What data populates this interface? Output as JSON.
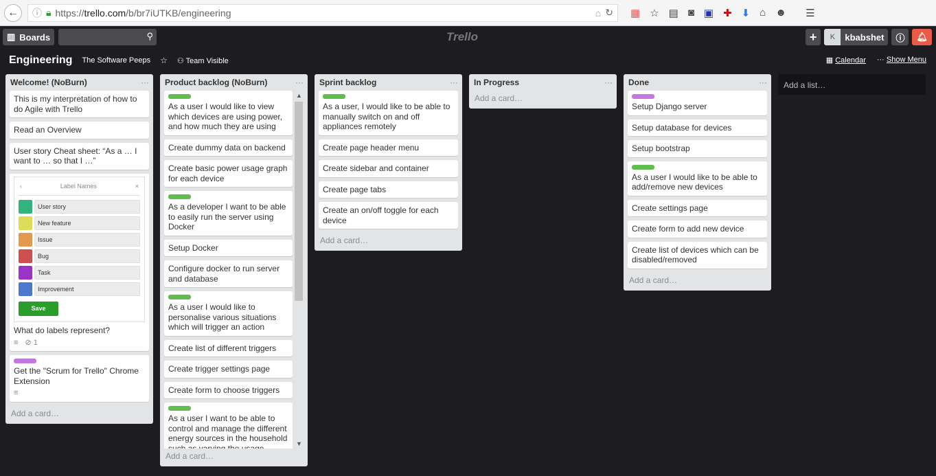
{
  "browser": {
    "url_prefix": "https://",
    "url_host": "trello.com",
    "url_path": "/b/br7iUTKB/engineering"
  },
  "topbar": {
    "boards_label": "Boards",
    "logo": "Trello",
    "user_initial": "K",
    "username": "kbabshet"
  },
  "board": {
    "title": "Engineering",
    "team": "The Software Peeps",
    "visibility": "Team Visible",
    "calendar": "Calendar",
    "show_menu": "Show Menu"
  },
  "add_card": "Add a card…",
  "add_list": "Add a list…",
  "colors": {
    "green": "#61bd4f",
    "purple": "#c377e0"
  },
  "lists": [
    {
      "title": "Welcome! (NoBurn)",
      "cards": [
        {
          "text": "This is my interpretation of how to do Agile with Trello"
        },
        {
          "text": "Read an Overview"
        },
        {
          "text": "User story Cheat sheet: “As a … I want to … so that I …”"
        },
        {
          "text": "What do labels represent?",
          "attachments": "1"
        },
        {
          "text": "Get the \"Scrum for Trello\" Chrome Extension",
          "label": "purple"
        }
      ]
    },
    {
      "title": "Product backlog (NoBurn)",
      "cards": [
        {
          "text": "As a user I would like to view which devices are using power, and how much they are using",
          "label": "green"
        },
        {
          "text": "Create dummy data on backend"
        },
        {
          "text": "Create basic power usage graph for each device"
        },
        {
          "text": "As a developer I want to be able to easily run the server using Docker",
          "label": "green"
        },
        {
          "text": "Setup Docker"
        },
        {
          "text": "Configure docker to run server and database"
        },
        {
          "text": "As a user I would like to personalise various situations which will trigger an action",
          "label": "green"
        },
        {
          "text": "Create list of different triggers"
        },
        {
          "text": "Create trigger settings page"
        },
        {
          "text": "Create form to choose triggers"
        },
        {
          "text": "As a user I want to be able to control and manage the different energy sources in the household such as varying the usage between them",
          "label": "green"
        }
      ]
    },
    {
      "title": "Sprint backlog",
      "cards": [
        {
          "text": "As a user, I would like to be able to manually switch on and off appliances remotely",
          "label": "green"
        },
        {
          "text": "Create page header menu"
        },
        {
          "text": "Create sidebar and container"
        },
        {
          "text": "Create page tabs"
        },
        {
          "text": "Create an on/off toggle for each device"
        }
      ]
    },
    {
      "title": "In Progress",
      "cards": []
    },
    {
      "title": "Done",
      "cards": [
        {
          "text": "Setup Django server",
          "label": "purple"
        },
        {
          "text": "Setup database for devices"
        },
        {
          "text": "Setup bootstrap"
        },
        {
          "text": "As a user I would like to be able to add/remove new devices",
          "label": "green"
        },
        {
          "text": "Create settings page"
        },
        {
          "text": "Create form to add new device"
        },
        {
          "text": "Create list of devices which can be disabled/removed"
        }
      ]
    }
  ],
  "label_popup": {
    "title": "Label Names",
    "save": "Save",
    "labels": [
      {
        "name": "User story",
        "color": "#33b37d"
      },
      {
        "name": "New feature",
        "color": "#dfdc55"
      },
      {
        "name": "Issue",
        "color": "#e39a4f"
      },
      {
        "name": "Bug",
        "color": "#cf4f51"
      },
      {
        "name": "Task",
        "color": "#9b33c9"
      },
      {
        "name": "Improvement",
        "color": "#4d78cf"
      }
    ]
  }
}
